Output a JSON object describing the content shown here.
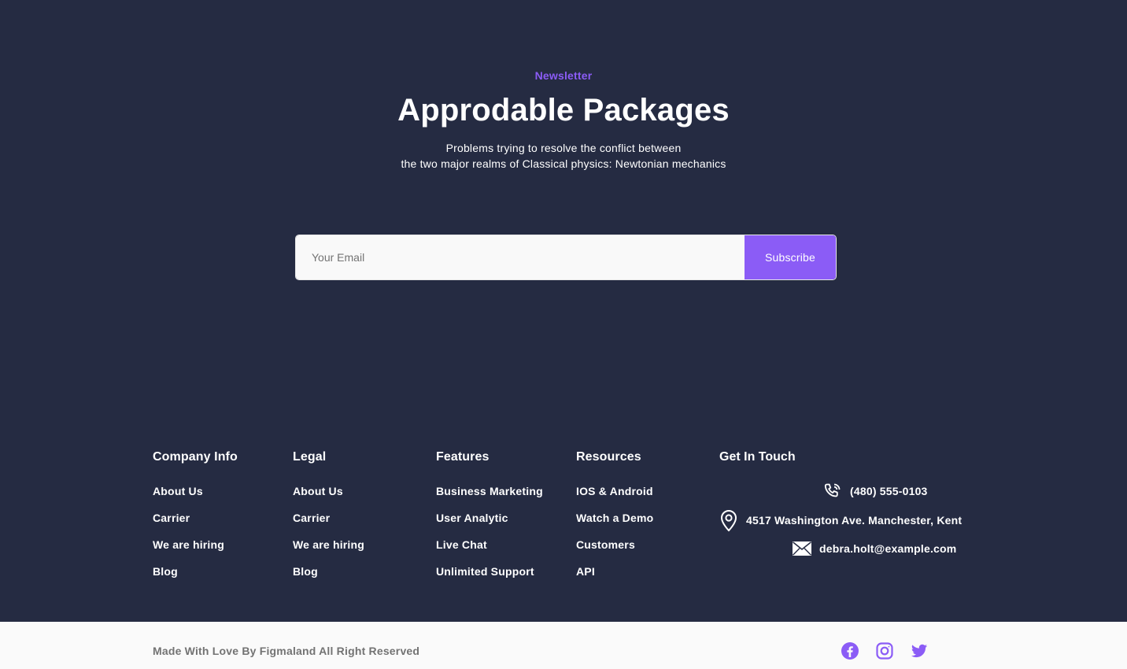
{
  "newsletter": {
    "eyebrow": "Newsletter",
    "title": "Approdable Packages",
    "subtitle_lines": [
      "Problems trying to resolve the conflict between",
      "the two major realms of Classical physics: Newtonian mechanics"
    ],
    "email_placeholder": "Your Email",
    "email_value": "",
    "button_label": "Subscribe"
  },
  "footer": {
    "columns": [
      {
        "title": "Company Info",
        "links": [
          "About Us",
          "Carrier",
          "We are hiring",
          "Blog"
        ]
      },
      {
        "title": "Legal",
        "links": [
          "About Us",
          "Carrier",
          "We are hiring",
          "Blog"
        ]
      },
      {
        "title": "Features",
        "links": [
          "Business Marketing",
          "User Analytic",
          "Live Chat",
          "Unlimited Support"
        ]
      },
      {
        "title": "Resources",
        "links": [
          "IOS & Android",
          "Watch a Demo",
          "Customers",
          "API"
        ]
      }
    ],
    "contact": {
      "title": "Get In Touch",
      "phone": "(480) 555-0103",
      "address": "4517 Washington Ave. Manchester, Kent",
      "email": "debra.holt@example.com"
    }
  },
  "bottom_bar": {
    "copyright": "Made With Love By Figmaland All Right Reserved",
    "socials": [
      "facebook-icon",
      "instagram-icon",
      "twitter-icon"
    ]
  },
  "colors": {
    "background": "#252b42",
    "accent": "#8b5cf6",
    "bottom_bar": "#fafafa",
    "muted_text": "#737373"
  }
}
